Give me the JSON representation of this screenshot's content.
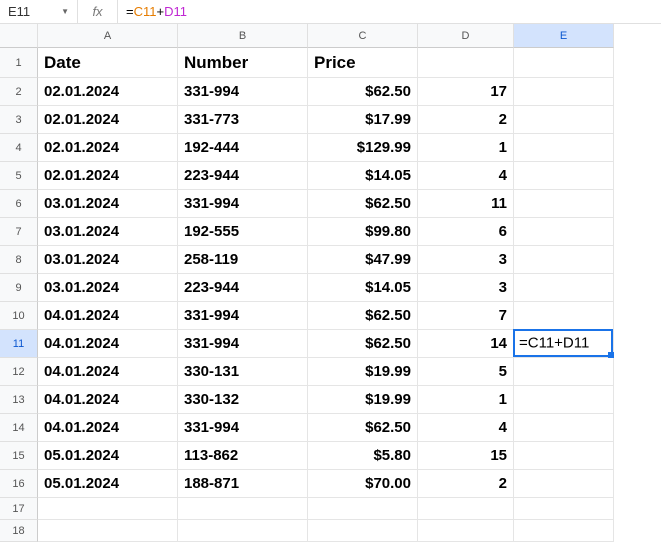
{
  "formula_bar": {
    "cell_ref": "E11",
    "fx_label": "fx",
    "formula": "=C11+D11"
  },
  "columns": [
    "A",
    "B",
    "C",
    "D",
    "E"
  ],
  "active_col": "E",
  "active_row": "11",
  "row_numbers": [
    "1",
    "2",
    "3",
    "4",
    "5",
    "6",
    "7",
    "8",
    "9",
    "10",
    "11",
    "12",
    "13",
    "14",
    "15",
    "16",
    "17",
    "18"
  ],
  "header_row": {
    "A": "Date",
    "B": "Number",
    "C": "Price",
    "D": "",
    "E": ""
  },
  "rows": [
    {
      "A": "02.01.2024",
      "B": "331-994",
      "C": "$62.50",
      "D": "17",
      "E": ""
    },
    {
      "A": "02.01.2024",
      "B": "331-773",
      "C": "$17.99",
      "D": "2",
      "E": ""
    },
    {
      "A": "02.01.2024",
      "B": "192-444",
      "C": "$129.99",
      "D": "1",
      "E": ""
    },
    {
      "A": "02.01.2024",
      "B": "223-944",
      "C": "$14.05",
      "D": "4",
      "E": ""
    },
    {
      "A": "03.01.2024",
      "B": "331-994",
      "C": "$62.50",
      "D": "11",
      "E": ""
    },
    {
      "A": "03.01.2024",
      "B": "192-555",
      "C": "$99.80",
      "D": "6",
      "E": ""
    },
    {
      "A": "03.01.2024",
      "B": "258-119",
      "C": "$47.99",
      "D": "3",
      "E": ""
    },
    {
      "A": "03.01.2024",
      "B": "223-944",
      "C": "$14.05",
      "D": "3",
      "E": ""
    },
    {
      "A": "04.01.2024",
      "B": "331-994",
      "C": "$62.50",
      "D": "7",
      "E": ""
    },
    {
      "A": "04.01.2024",
      "B": "331-994",
      "C": "$62.50",
      "D": "14",
      "E": "=C11+D11"
    },
    {
      "A": "04.01.2024",
      "B": "330-131",
      "C": "$19.99",
      "D": "5",
      "E": ""
    },
    {
      "A": "04.01.2024",
      "B": "330-132",
      "C": "$19.99",
      "D": "1",
      "E": ""
    },
    {
      "A": "04.01.2024",
      "B": "331-994",
      "C": "$62.50",
      "D": "4",
      "E": ""
    },
    {
      "A": "05.01.2024",
      "B": "113-862",
      "C": "$5.80",
      "D": "15",
      "E": ""
    },
    {
      "A": "05.01.2024",
      "B": "188-871",
      "C": "$70.00",
      "D": "2",
      "E": ""
    },
    {
      "A": "",
      "B": "",
      "C": "",
      "D": "",
      "E": ""
    },
    {
      "A": "",
      "B": "",
      "C": "",
      "D": "",
      "E": ""
    }
  ],
  "row_heights": {
    "header": 30,
    "data": 28,
    "empty": 22
  },
  "col_widths": {
    "A": 140,
    "B": 130,
    "C": 110,
    "D": 96,
    "E": 100
  }
}
